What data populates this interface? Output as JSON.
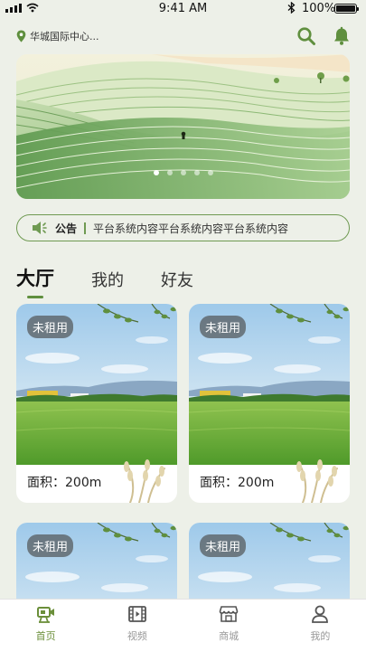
{
  "status": {
    "time": "9:41 AM",
    "battery": "100%"
  },
  "header": {
    "location": "华城国际中心..."
  },
  "banner": {
    "dot_count": 5,
    "active_dot": 0
  },
  "notice": {
    "label": "公告",
    "text": "平台系统内容平台系统内容平台系统内容"
  },
  "tabs": [
    {
      "label": "大厅",
      "active": true
    },
    {
      "label": "我的",
      "active": false
    },
    {
      "label": "好友",
      "active": false
    }
  ],
  "cards": [
    {
      "tag": "未租用",
      "area": "面积：200m"
    },
    {
      "tag": "未租用",
      "area": "面积：200m"
    },
    {
      "tag": "未租用"
    },
    {
      "tag": "未租用"
    }
  ],
  "nav": [
    {
      "label": "首页",
      "icon": "video-camera-icon",
      "active": true
    },
    {
      "label": "视频",
      "icon": "film-icon",
      "active": false
    },
    {
      "label": "商城",
      "icon": "store-icon",
      "active": false
    },
    {
      "label": "我的",
      "icon": "user-icon",
      "active": false
    }
  ],
  "colors": {
    "accent": "#6b8f3a",
    "background": "#edf0e8"
  }
}
